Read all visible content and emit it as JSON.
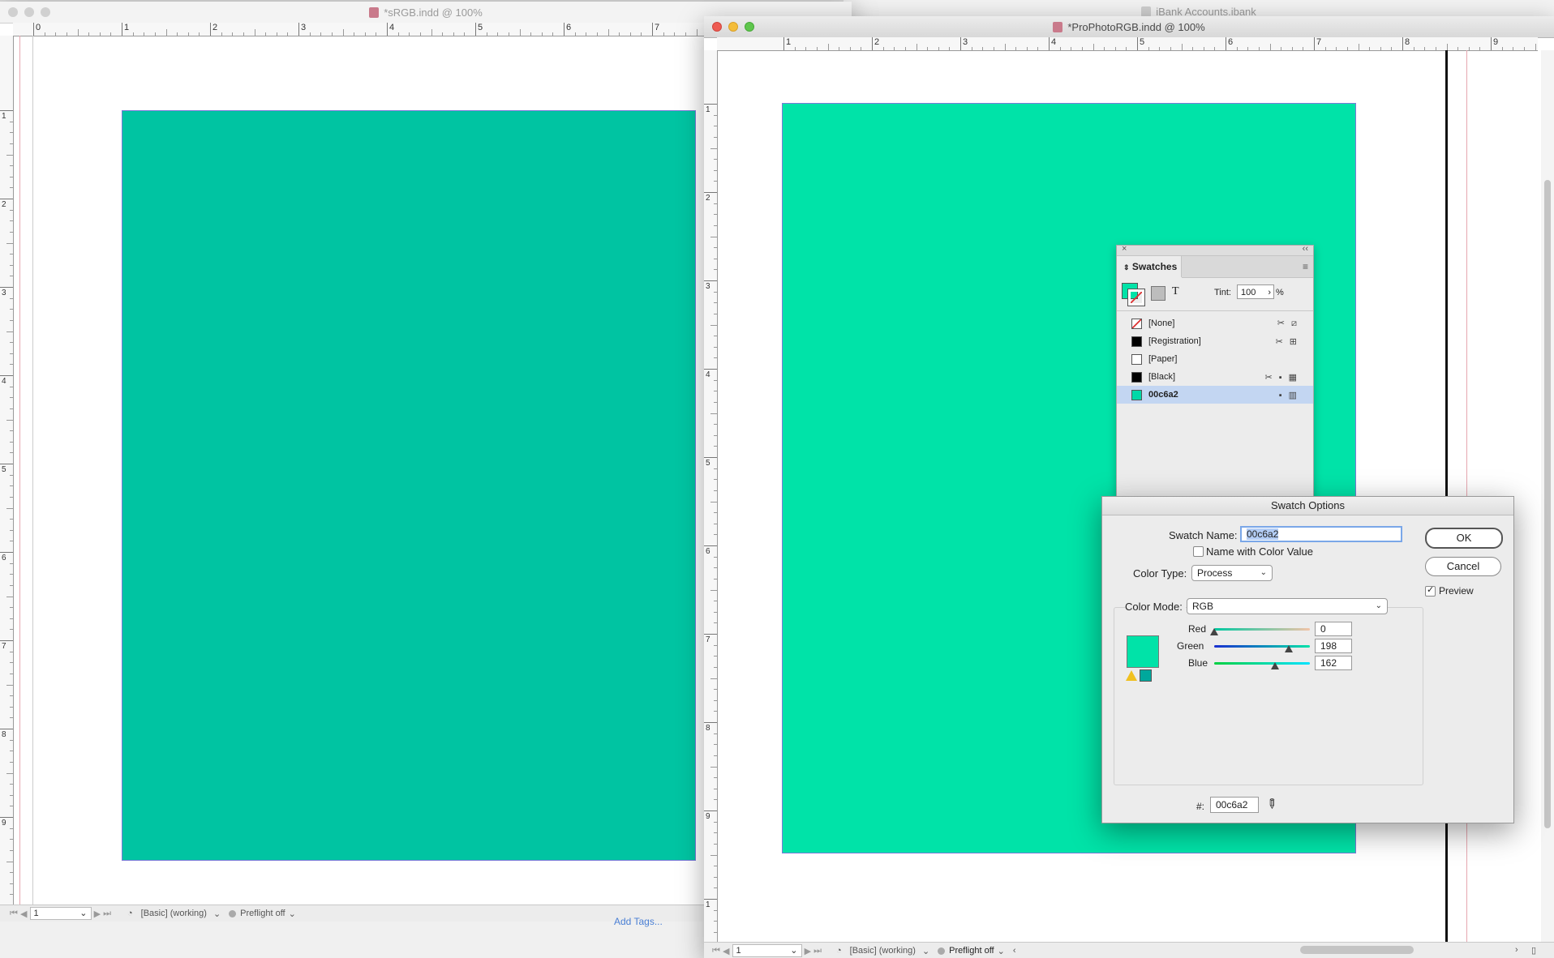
{
  "background_window": {
    "title": "iBank Accounts.ibank"
  },
  "window_left": {
    "title": "*sRGB.indd @ 100%",
    "ruler_numbers": [
      "0",
      "1",
      "2",
      "3",
      "4",
      "5",
      "6",
      "7"
    ],
    "ruler_v_numbers": [
      "1",
      "2",
      "3",
      "4",
      "5",
      "6",
      "7",
      "8",
      "9"
    ],
    "swatch_color": "#00c4a2",
    "status": {
      "page": "1",
      "style": "[Basic] (working)",
      "preflight": "Preflight off"
    },
    "below_text": "Add Tags..."
  },
  "window_right": {
    "title": "*ProPhotoRGB.indd @ 100%",
    "ruler_numbers": [
      "1",
      "2",
      "3",
      "4",
      "5",
      "6",
      "7",
      "8",
      "9"
    ],
    "ruler_v_numbers": [
      "1",
      "2",
      "3",
      "4",
      "5",
      "6",
      "7",
      "8",
      "9",
      "1"
    ],
    "swatch_color": "#00e3a8",
    "status": {
      "page": "1",
      "style": "[Basic] (working)",
      "preflight": "Preflight off"
    }
  },
  "swatches_panel": {
    "title": "Swatches",
    "tint_label": "Tint:",
    "tint_value": "100",
    "tint_unit": "%",
    "text_glyph": "T",
    "items": [
      {
        "name": "[None]",
        "color": "none"
      },
      {
        "name": "[Registration]",
        "color": "#000000"
      },
      {
        "name": "[Paper]",
        "color": "#ffffff"
      },
      {
        "name": "[Black]",
        "color": "#000000"
      },
      {
        "name": "00c6a2",
        "color": "#00d8a8",
        "selected": true
      }
    ]
  },
  "swatch_options": {
    "title": "Swatch Options",
    "swatch_name_label": "Swatch Name:",
    "swatch_name_value": "00c6a2",
    "name_with_color_label": "Name with Color Value",
    "color_type_label": "Color Type:",
    "color_type_value": "Process",
    "color_mode_label": "Color Mode:",
    "color_mode_value": "RGB",
    "ok_label": "OK",
    "cancel_label": "Cancel",
    "preview_label": "Preview",
    "preview_checked": true,
    "channels": [
      {
        "name": "Red",
        "value": "0",
        "level": 0.0
      },
      {
        "name": "Green",
        "value": "198",
        "level": 0.776
      },
      {
        "name": "Blue",
        "value": "162",
        "level": 0.635
      }
    ],
    "hex_label": "#:",
    "hex_value": "00c6a2",
    "preview_color": "#00e3a8",
    "gamut_color": "#00a89c"
  }
}
